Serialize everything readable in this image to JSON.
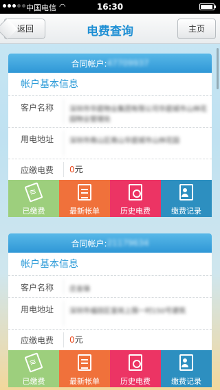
{
  "status_bar": {
    "carrier": "中国电信",
    "time": "16:30",
    "battery_level": 0.95
  },
  "nav": {
    "back_label": "返回",
    "title": "电费查询",
    "home_label": "主页"
  },
  "accounts": [
    {
      "header_label": "合同帐户:",
      "account_no": "47709937",
      "section_title": "帐户基本信息",
      "name_label": "客户名称",
      "name_value": "深圳市华庭物业集团有限公司华庭城市山林花园物业管理处",
      "address_label": "用电地址",
      "address_value": "深圳市南山区南山华庭城市山林花园",
      "due_label": "应缴电费",
      "due_amount": "0",
      "due_unit": "元",
      "actions": [
        "已缴费",
        "最新帐单",
        "历史电费",
        "缴费记录"
      ]
    },
    {
      "header_label": "合同帐户:",
      "account_no": "21179634",
      "section_title": "帐户基本信息",
      "name_label": "客户名称",
      "name_value": "庄金锋",
      "address_label": "用电地址",
      "address_value": "深圳市福田区皇岗上围一村150号建筑",
      "due_label": "应缴电费",
      "due_amount": "0",
      "due_unit": "元",
      "actions": [
        "已缴费",
        "最新帐单",
        "历史电费",
        "缴费记录"
      ]
    }
  ],
  "icons": {
    "paid": "ticket-icon",
    "bill": "document-icon",
    "history": "certificate-icon",
    "records": "contact-book-icon"
  },
  "colors": {
    "title_blue": "#1f8fd4",
    "header_blue": "#2f97d6",
    "paid_green": "#9dcf7d",
    "bill_orange": "#f0713b",
    "history_pink": "#ec3464",
    "records_blue": "#2d8fc0",
    "amount_red": "#e94a1f"
  }
}
